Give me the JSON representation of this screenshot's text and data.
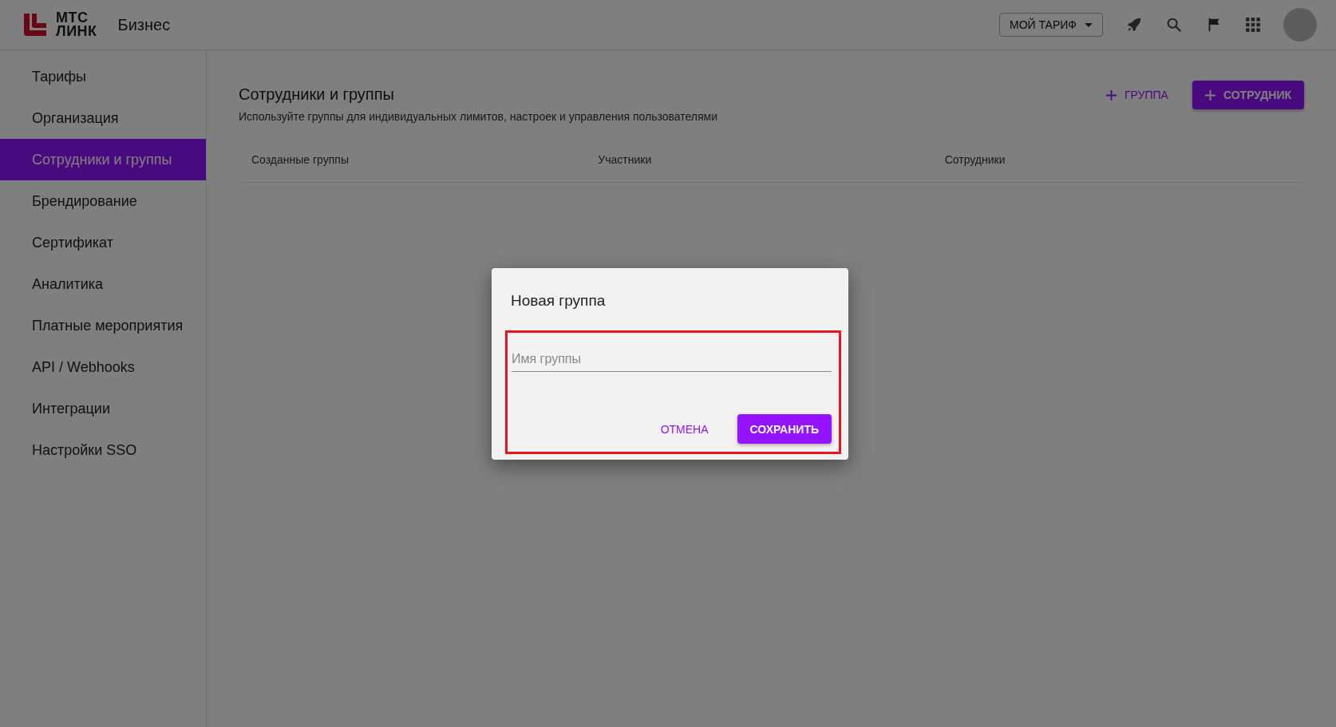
{
  "header": {
    "logo_lines": [
      "МТС",
      "ЛИНК"
    ],
    "product": "Бизнес",
    "tariff_button": "МОЙ ТАРИФ"
  },
  "sidebar": {
    "items": [
      {
        "label": "Тарифы",
        "selected": false
      },
      {
        "label": "Организация",
        "selected": false
      },
      {
        "label": "Сотрудники и группы",
        "selected": true
      },
      {
        "label": "Брендирование",
        "selected": false
      },
      {
        "label": "Сертификат",
        "selected": false
      },
      {
        "label": "Аналитика",
        "selected": false
      },
      {
        "label": "Платные мероприятия",
        "selected": false
      },
      {
        "label": "API / Webhooks",
        "selected": false
      },
      {
        "label": "Интеграции",
        "selected": false
      },
      {
        "label": "Настройки SSO",
        "selected": false
      }
    ]
  },
  "page": {
    "title": "Сотрудники и группы",
    "subtitle": "Используйте группы для индивидуальных лимитов, настроек и управления пользователями",
    "add_group_button": "ГРУППА",
    "add_employee_button": "СОТРУДНИК"
  },
  "table": {
    "columns": [
      "Созданные группы",
      "Участники",
      "Сотрудники"
    ]
  },
  "dialog": {
    "title": "Новая группа",
    "field": {
      "placeholder": "Имя группы"
    },
    "cancel_button": "ОТМЕНА",
    "save_button": "СОХРАНИТЬ"
  }
}
